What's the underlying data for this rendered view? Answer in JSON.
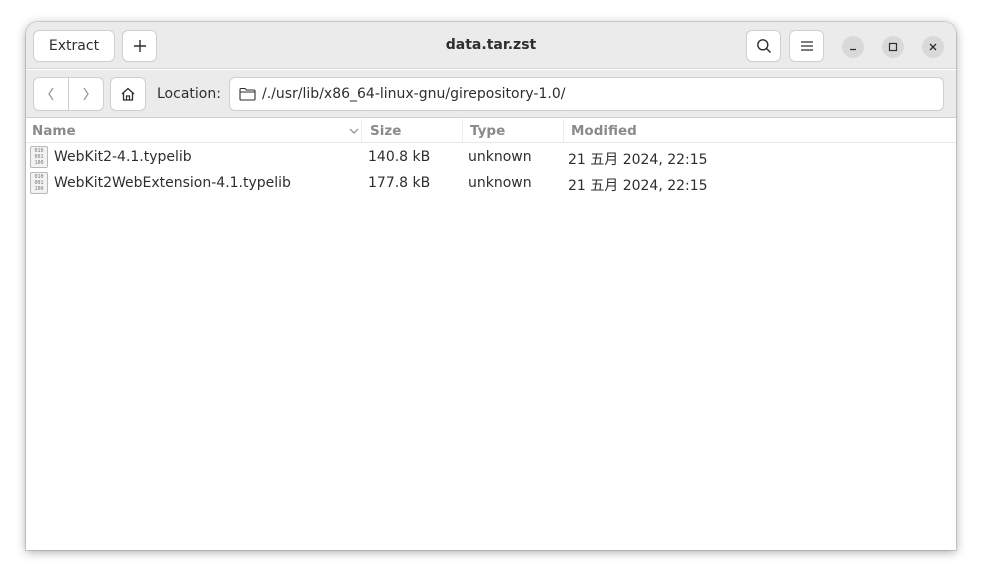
{
  "window": {
    "title": "data.tar.zst"
  },
  "headerbar": {
    "extract_label": "Extract",
    "add_icon": "plus-icon",
    "search_icon": "search-icon",
    "menu_icon": "hamburger-menu-icon",
    "minimize_icon": "minimize-icon",
    "maximize_icon": "maximize-icon",
    "close_icon": "close-icon"
  },
  "location_bar": {
    "back_icon": "chevron-left-icon",
    "forward_icon": "chevron-right-icon",
    "home_icon": "home-icon",
    "label": "Location:",
    "folder_icon": "folder-icon",
    "path": "/./usr/lib/x86_64-linux-gnu/girepository-1.0/"
  },
  "table": {
    "columns": [
      "Name",
      "Size",
      "Type",
      "Modified"
    ],
    "sort_icon": "chevron-down-icon",
    "rows": [
      {
        "icon": "binary-file-icon",
        "name": "WebKit2-4.1.typelib",
        "size": "140.8 kB",
        "type": "unknown",
        "modified": "21 五月 2024, 22:15"
      },
      {
        "icon": "binary-file-icon",
        "name": "WebKit2WebExtension-4.1.typelib",
        "size": "177.8 kB",
        "type": "unknown",
        "modified": "21 五月 2024, 22:15"
      }
    ]
  },
  "colors": {
    "headerbar_bg": "#ebebeb",
    "window_bg": "#ffffff",
    "text": "#2e2e2e",
    "column_header_text": "#8a8a8a"
  }
}
